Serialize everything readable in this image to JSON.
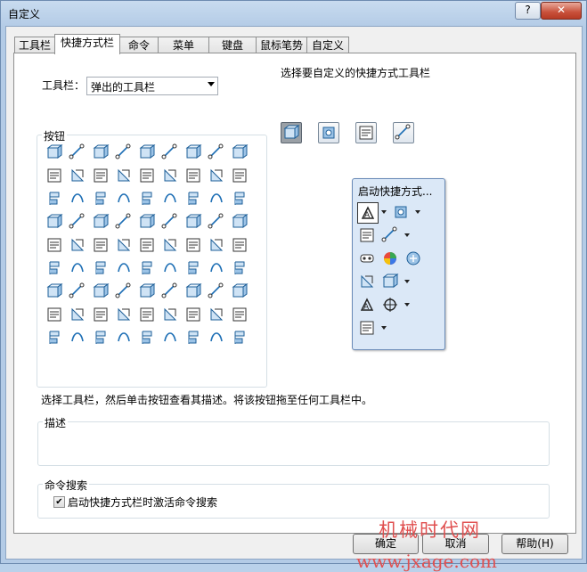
{
  "window": {
    "title": "自定义",
    "help_label": "?",
    "close_label": "✕"
  },
  "tabs": [
    {
      "label": "工具栏"
    },
    {
      "label": "快捷方式栏"
    },
    {
      "label": "命令"
    },
    {
      "label": "菜单"
    },
    {
      "label": "键盘"
    },
    {
      "label": "鼠标笔势"
    },
    {
      "label": "自定义"
    }
  ],
  "toolbar_select": {
    "label": "工具栏：",
    "value": "弹出的工具栏"
  },
  "shortcut_toolbar_heading": "选择要自定义的快捷方式工具栏",
  "shortcut_toolbars": [
    {
      "icon": "part-shortcut-icon",
      "selected": true
    },
    {
      "icon": "assembly-shortcut-icon",
      "selected": false
    },
    {
      "icon": "drawing-shortcut-icon",
      "selected": false
    },
    {
      "icon": "sketch-shortcut-icon",
      "selected": false
    }
  ],
  "buttons_group": {
    "label": "按钮",
    "columns": 9,
    "rows": 9
  },
  "hint_text": "选择工具栏，然后单击按钮查看其描述。将该按钮拖至任何工具栏中。",
  "description_group": {
    "label": "描述",
    "text": ""
  },
  "popup": {
    "title": "启动快捷方式...",
    "rows": [
      [
        "select-arrow-icon",
        "drop",
        "convert-edges-icon",
        "drop"
      ],
      [
        "extrude-boss-icon",
        "extrude-cut-icon",
        "drop"
      ],
      [
        "revolve-icon",
        "sweep-icon",
        "loft-icon"
      ],
      [
        "fillet-icon",
        "chamfer-icon",
        "drop"
      ],
      [
        "shell-icon",
        "spline-icon",
        "drop"
      ],
      [
        "reference-plane-icon",
        "drop"
      ]
    ]
  },
  "command_search": {
    "group_label": "命令搜索",
    "checkbox_label": "启动快捷方式栏时激活命令搜索",
    "checked": true
  },
  "footer": {
    "ok_label": "确定",
    "cancel_label": "取消",
    "help_label": "帮助(H)"
  },
  "watermark": {
    "line1": "机械时代网",
    "line2": "www.jxage.com"
  },
  "colors": {
    "accent_blue": "#1e6fb5",
    "watermark_red": "#e05050"
  }
}
